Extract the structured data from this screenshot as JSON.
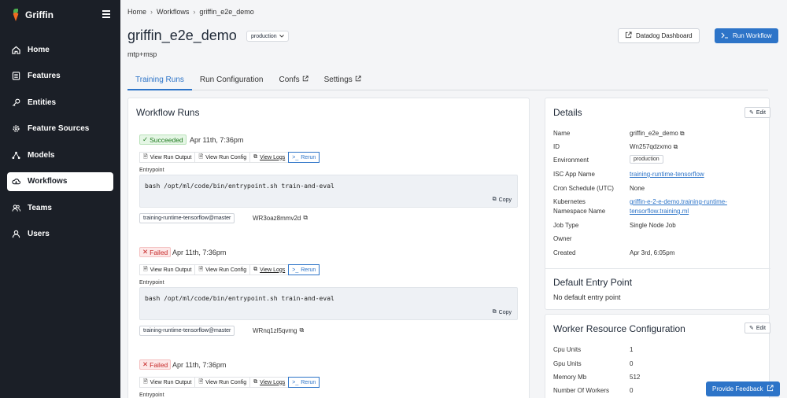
{
  "sidebar": {
    "brand": "Griffin",
    "items": [
      {
        "label": "Home",
        "icon": "home-icon"
      },
      {
        "label": "Features",
        "icon": "list-icon"
      },
      {
        "label": "Entities",
        "icon": "key-icon"
      },
      {
        "label": "Feature Sources",
        "icon": "gear-icon"
      },
      {
        "label": "Models",
        "icon": "model-icon"
      },
      {
        "label": "Workflows",
        "icon": "cloud-icon"
      },
      {
        "label": "Teams",
        "icon": "team-icon"
      },
      {
        "label": "Users",
        "icon": "user-icon"
      }
    ],
    "active_index": 5
  },
  "breadcrumb": [
    "Home",
    "Workflows",
    "griffin_e2e_demo"
  ],
  "header": {
    "title": "griffin_e2e_demo",
    "env": "production",
    "subtitle": "mtp+msp",
    "datadog_label": "Datadog Dashboard",
    "run_label": "Run Workflow"
  },
  "tabs": [
    "Training Runs",
    "Run Configuration",
    "Confs",
    "Settings"
  ],
  "runs_card": {
    "title": "Workflow Runs",
    "actions": {
      "output": "View Run Output",
      "config": "View Run Config",
      "logs": "View Logs",
      "rerun": "Rerun"
    },
    "entry_label": "Entrypoint",
    "copy_label": "Copy",
    "runs": [
      {
        "status": "Succeeded",
        "time": "Apr 11th, 7:36pm",
        "command": "bash /opt/ml/code/bin/entrypoint.sh train-and-eval",
        "tag": "training-runtime-tensorflow@master",
        "hash": "WR3oaz8mmv2d"
      },
      {
        "status": "Failed",
        "time": "Apr 11th, 7:36pm",
        "command": "bash /opt/ml/code/bin/entrypoint.sh train-and-eval",
        "tag": "training-runtime-tensorflow@master",
        "hash": "WRnq1zl5qvmg"
      },
      {
        "status": "Failed",
        "time": "Apr 11th, 7:36pm",
        "partial_label": "Entrypoint"
      }
    ]
  },
  "details": {
    "title": "Details",
    "edit_label": "Edit",
    "rows": [
      {
        "label": "Name",
        "value": "griffin_e2e_demo"
      },
      {
        "label": "ID",
        "value": "Wn257qdzxmo"
      },
      {
        "label": "Environment",
        "value": "production"
      },
      {
        "label": "ISC App Name",
        "value": "training-runtime-tensorflow"
      },
      {
        "label": "Cron Schedule (UTC)",
        "value": "None"
      },
      {
        "label": "Kubernetes",
        "label2": "Namespace Name",
        "value": "griffin-e-2-e-demo.training-runtime-",
        "value2": "tensorflow.training.ml"
      },
      {
        "label": "Job Type",
        "value": "Single Node Job"
      },
      {
        "label": "Owner",
        "value": ""
      },
      {
        "label": "Created",
        "value": "Apr 3rd, 6:05pm"
      }
    ],
    "entry_title": "Default Entry Point",
    "entry_value": "No default entry point"
  },
  "worker": {
    "title": "Worker Resource Configuration",
    "edit_label": "Edit",
    "rows": [
      {
        "label": "Cpu Units",
        "value": "1"
      },
      {
        "label": "Gpu Units",
        "value": "0"
      },
      {
        "label": "Memory Mb",
        "value": "512"
      },
      {
        "label": "Number Of Workers",
        "value": "0"
      }
    ]
  },
  "feedback_label": "Provide Feedback",
  "colors": {
    "sidebar": "#1b1f27",
    "accent": "#2d74c8",
    "success": "#1f7a1f",
    "danger": "#c62828"
  }
}
